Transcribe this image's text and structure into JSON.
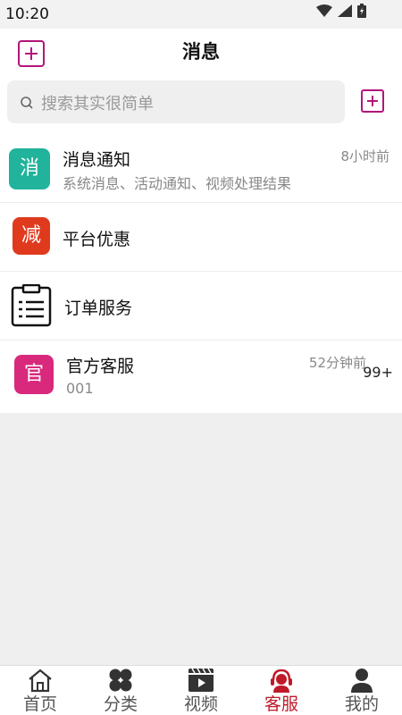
{
  "status": {
    "time": "10:20"
  },
  "header": {
    "title": "消息"
  },
  "search": {
    "placeholder": "搜索其实很简单"
  },
  "conversations": [
    {
      "avatar_text": "消",
      "avatar_color": "#21b39b",
      "title": "消息通知",
      "subtitle": "系统消息、活动通知、视频处理结果",
      "time": "8小时前"
    },
    {
      "avatar_text": "减",
      "avatar_color": "#e03a1e",
      "title": "平台优惠"
    },
    {
      "icon": "clipboard-list-icon",
      "title": "订单服务"
    },
    {
      "avatar_text": "官",
      "avatar_color": "#d8297d",
      "title": "官方客服",
      "subtitle": "001",
      "time": "52分钟前",
      "badge": "99+"
    }
  ],
  "tabs": [
    {
      "label": "首页",
      "icon": "home-icon"
    },
    {
      "label": "分类",
      "icon": "category-icon"
    },
    {
      "label": "视频",
      "icon": "video-icon"
    },
    {
      "label": "客服",
      "icon": "customer-service-icon",
      "active": true
    },
    {
      "label": "我的",
      "icon": "profile-icon"
    }
  ],
  "colors": {
    "accent": "#b2167a",
    "active_tab": "#c01a2a"
  }
}
